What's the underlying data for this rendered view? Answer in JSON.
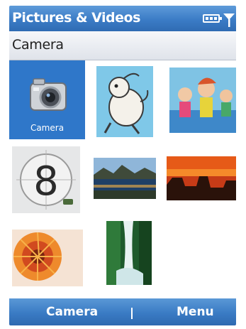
{
  "titlebar": {
    "title": "Pictures & Videos",
    "icons": [
      "battery-icon",
      "signal-icon"
    ],
    "color": "#3b7cc6"
  },
  "section": {
    "label": "Camera"
  },
  "grid": {
    "items": [
      {
        "label": "Camera",
        "icon": "camera-icon",
        "selected": true
      },
      {
        "label": "",
        "icon": "cartoon-character-thumbnail"
      },
      {
        "label": "",
        "icon": "cartoon-children-thumbnail"
      },
      {
        "label": "",
        "icon": "film-countdown-thumbnail"
      },
      {
        "label": "",
        "icon": "lake-landscape-thumbnail"
      },
      {
        "label": "",
        "icon": "sunset-mesa-thumbnail"
      },
      {
        "label": "",
        "icon": "flower-closeup-thumbnail"
      },
      {
        "label": "",
        "icon": "waterfall-thumbnail"
      }
    ],
    "countdown_digit": "8",
    "selection_color": "#2f77c9"
  },
  "softkeys": {
    "left": "Camera",
    "right": "Menu"
  }
}
